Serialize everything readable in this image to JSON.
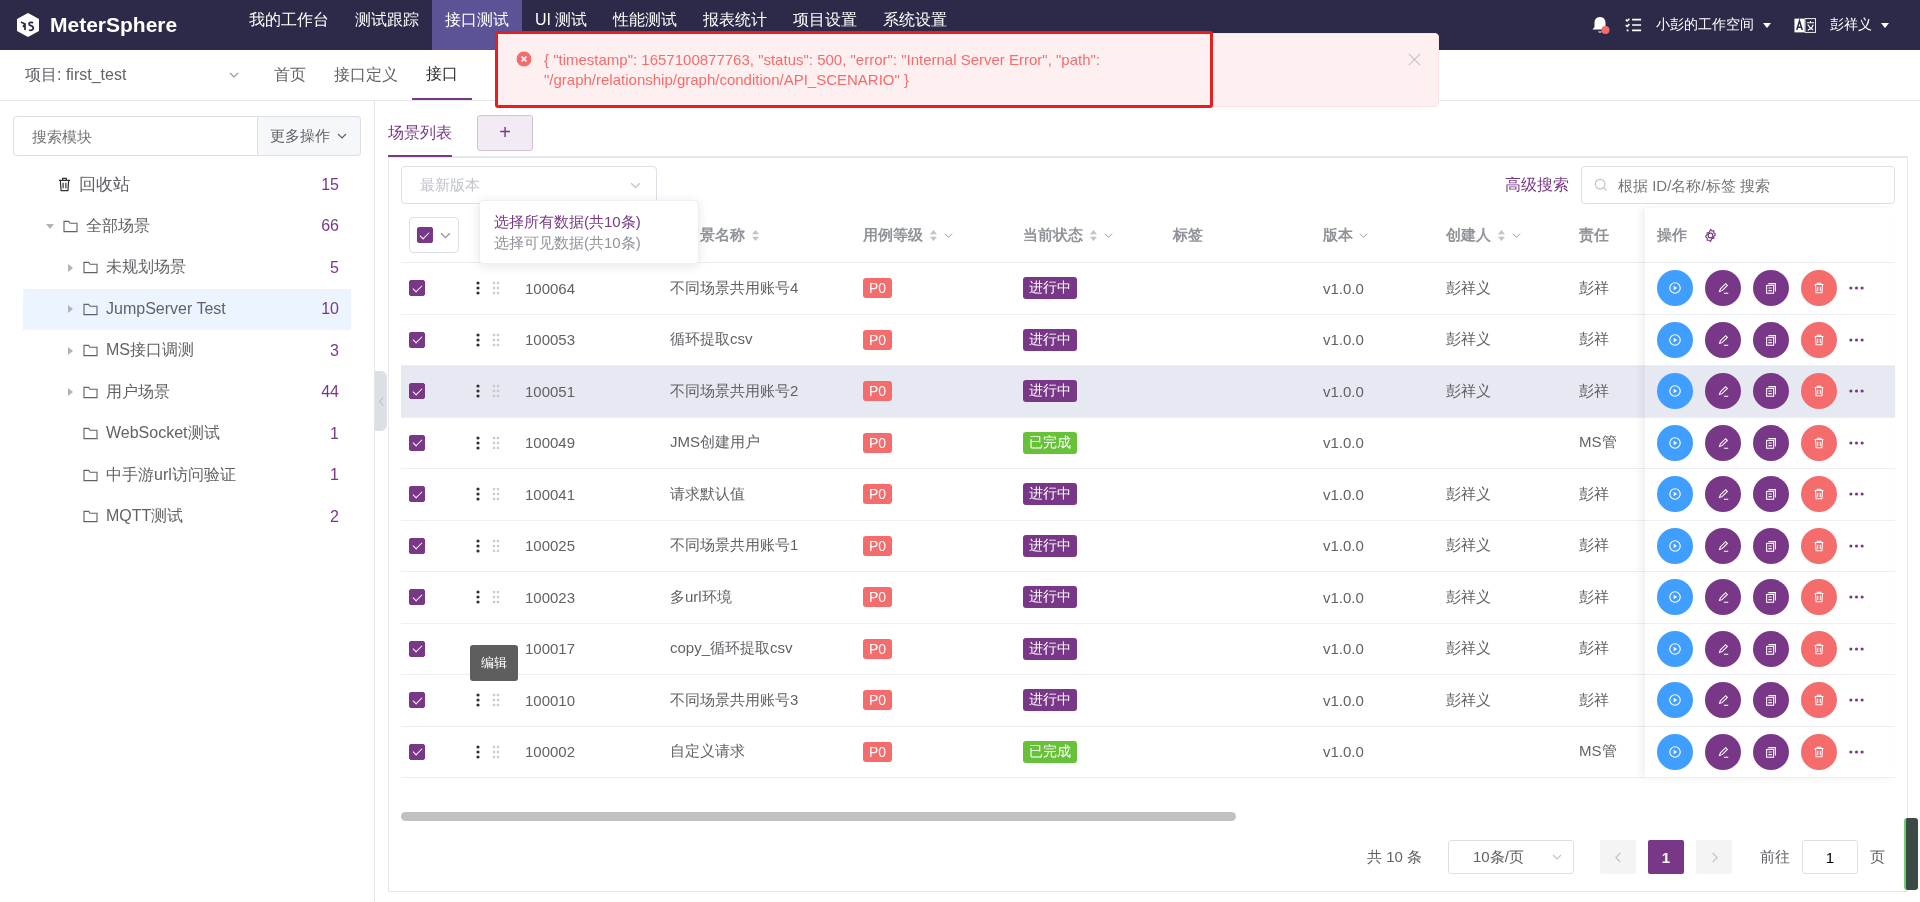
{
  "top_nav": {
    "brand": "MeterSphere",
    "menu": [
      {
        "label": "我的工作台",
        "selected": false
      },
      {
        "label": "测试跟踪",
        "selected": false
      },
      {
        "label": "接口测试",
        "selected": true
      },
      {
        "label": "UI 测试",
        "selected": false
      },
      {
        "label": "性能测试",
        "selected": false
      },
      {
        "label": "报表统计",
        "selected": false
      },
      {
        "label": "项目设置",
        "selected": false
      },
      {
        "label": "系统设置",
        "selected": false
      }
    ],
    "has_unread": true,
    "workspace": "小彭的工作空间",
    "user": "彭祥义"
  },
  "sub_nav": {
    "project": "项目: first_test",
    "tabs": [
      {
        "label": "首页",
        "selected": false
      },
      {
        "label": "接口定义",
        "selected": false
      },
      {
        "label": "接口",
        "selected": true
      }
    ]
  },
  "toast": {
    "kind": "error",
    "lines": [
      "{ \"timestamp\": 1657100877763, \"status\": 500, \"error\": \"Internal Server Error\", \"path\":",
      "\"/graph/relationship/graph/condition/API_SCENARIO\" }"
    ]
  },
  "sidebar": {
    "search_placeholder": "搜索模块",
    "more_button": "更多操作",
    "trash": {
      "label": "回收站",
      "count": "15"
    },
    "tree": [
      {
        "label": "全部场景",
        "count": "66",
        "expanded": true,
        "expandable": true,
        "selected": false,
        "children": [
          {
            "label": "未规划场景",
            "count": "5",
            "expandable": true,
            "expanded": false,
            "selected": false
          },
          {
            "label": "JumpServer Test",
            "count": "10",
            "expandable": true,
            "expanded": false,
            "selected": true
          },
          {
            "label": "MS接口调测",
            "count": "3",
            "expandable": true,
            "expanded": false,
            "selected": false
          },
          {
            "label": "用户场景",
            "count": "44",
            "expandable": true,
            "expanded": false,
            "selected": false
          },
          {
            "label": "WebSocket测试",
            "count": "1",
            "expandable": false,
            "selected": false
          },
          {
            "label": "中手游url访问验证",
            "count": "1",
            "expandable": false,
            "selected": false
          },
          {
            "label": "MQTT测试",
            "count": "2",
            "expandable": false,
            "selected": false
          }
        ]
      }
    ]
  },
  "main": {
    "tabs": [
      {
        "label": "场景列表",
        "selected": true
      }
    ],
    "add_button": "+",
    "version_placeholder": "最新版本",
    "advanced_search": "高级搜索",
    "search_placeholder": "根据 ID/名称/标签 搜索",
    "table": {
      "all_checked": true,
      "select_menu": [
        {
          "label": "选择所有数据(共10条)",
          "selected": true
        },
        {
          "label": "选择可见数据(共10条)",
          "selected": false
        }
      ],
      "columns": [
        {
          "label": "景名称",
          "sortable": true
        },
        {
          "label": "用例等级",
          "sortable": true,
          "filterable": true
        },
        {
          "label": "当前状态",
          "sortable": true,
          "filterable": true
        },
        {
          "label": "标签"
        },
        {
          "label": "版本",
          "filterable": true
        },
        {
          "label": "创建人",
          "sortable": true,
          "filterable": true
        },
        {
          "label": "责任"
        }
      ],
      "actions_header": "操作",
      "rows": [
        {
          "checked": true,
          "hovered": false,
          "id": "100064",
          "name": "不同场景共用账号4",
          "level": "P0",
          "status": {
            "label": "进行中",
            "kind": "running"
          },
          "version": "v1.0.0",
          "creator": "彭祥义",
          "owner": "彭祥"
        },
        {
          "checked": true,
          "hovered": false,
          "id": "100053",
          "name": "循环提取csv",
          "level": "P0",
          "status": {
            "label": "进行中",
            "kind": "running"
          },
          "version": "v1.0.0",
          "creator": "彭祥义",
          "owner": "彭祥"
        },
        {
          "checked": true,
          "hovered": true,
          "id": "100051",
          "name": "不同场景共用账号2",
          "level": "P0",
          "status": {
            "label": "进行中",
            "kind": "running"
          },
          "version": "v1.0.0",
          "creator": "彭祥义",
          "owner": "彭祥"
        },
        {
          "checked": true,
          "hovered": false,
          "id": "100049",
          "name": "JMS创建用户",
          "level": "P0",
          "status": {
            "label": "已完成",
            "kind": "done"
          },
          "version": "v1.0.0",
          "owner": "MS管"
        },
        {
          "checked": true,
          "hovered": false,
          "id": "100041",
          "name": "请求默认值",
          "level": "P0",
          "status": {
            "label": "进行中",
            "kind": "running"
          },
          "version": "v1.0.0",
          "creator": "彭祥义",
          "owner": "彭祥"
        },
        {
          "checked": true,
          "hovered": false,
          "id": "100025",
          "name": "不同场景共用账号1",
          "level": "P0",
          "status": {
            "label": "进行中",
            "kind": "running"
          },
          "version": "v1.0.0",
          "creator": "彭祥义",
          "owner": "彭祥"
        },
        {
          "checked": true,
          "hovered": false,
          "id": "100023",
          "name": "多url环境",
          "level": "P0",
          "status": {
            "label": "进行中",
            "kind": "running"
          },
          "version": "v1.0.0",
          "creator": "彭祥义",
          "owner": "彭祥"
        },
        {
          "checked": true,
          "hovered": false,
          "id": "100017",
          "name": "copy_循环提取csv",
          "level": "P0",
          "status": {
            "label": "进行中",
            "kind": "running"
          },
          "version": "v1.0.0",
          "creator": "彭祥义",
          "owner": "彭祥",
          "tooltip": "编辑"
        },
        {
          "checked": true,
          "hovered": false,
          "id": "100010",
          "name": "不同场景共用账号3",
          "level": "P0",
          "status": {
            "label": "进行中",
            "kind": "running"
          },
          "version": "v1.0.0",
          "creator": "彭祥义",
          "owner": "彭祥"
        },
        {
          "checked": true,
          "hovered": false,
          "id": "100002",
          "name": "自定义请求",
          "level": "P0",
          "status": {
            "label": "已完成",
            "kind": "done"
          },
          "version": "v1.0.0",
          "owner": "MS管"
        }
      ]
    },
    "pagination": {
      "total": "共 10 条",
      "page_size": "10条/页",
      "pages": [
        {
          "label": "1",
          "selected": true
        }
      ],
      "goto_label": "前往",
      "goto_value": "1",
      "page_suffix": "页"
    }
  }
}
